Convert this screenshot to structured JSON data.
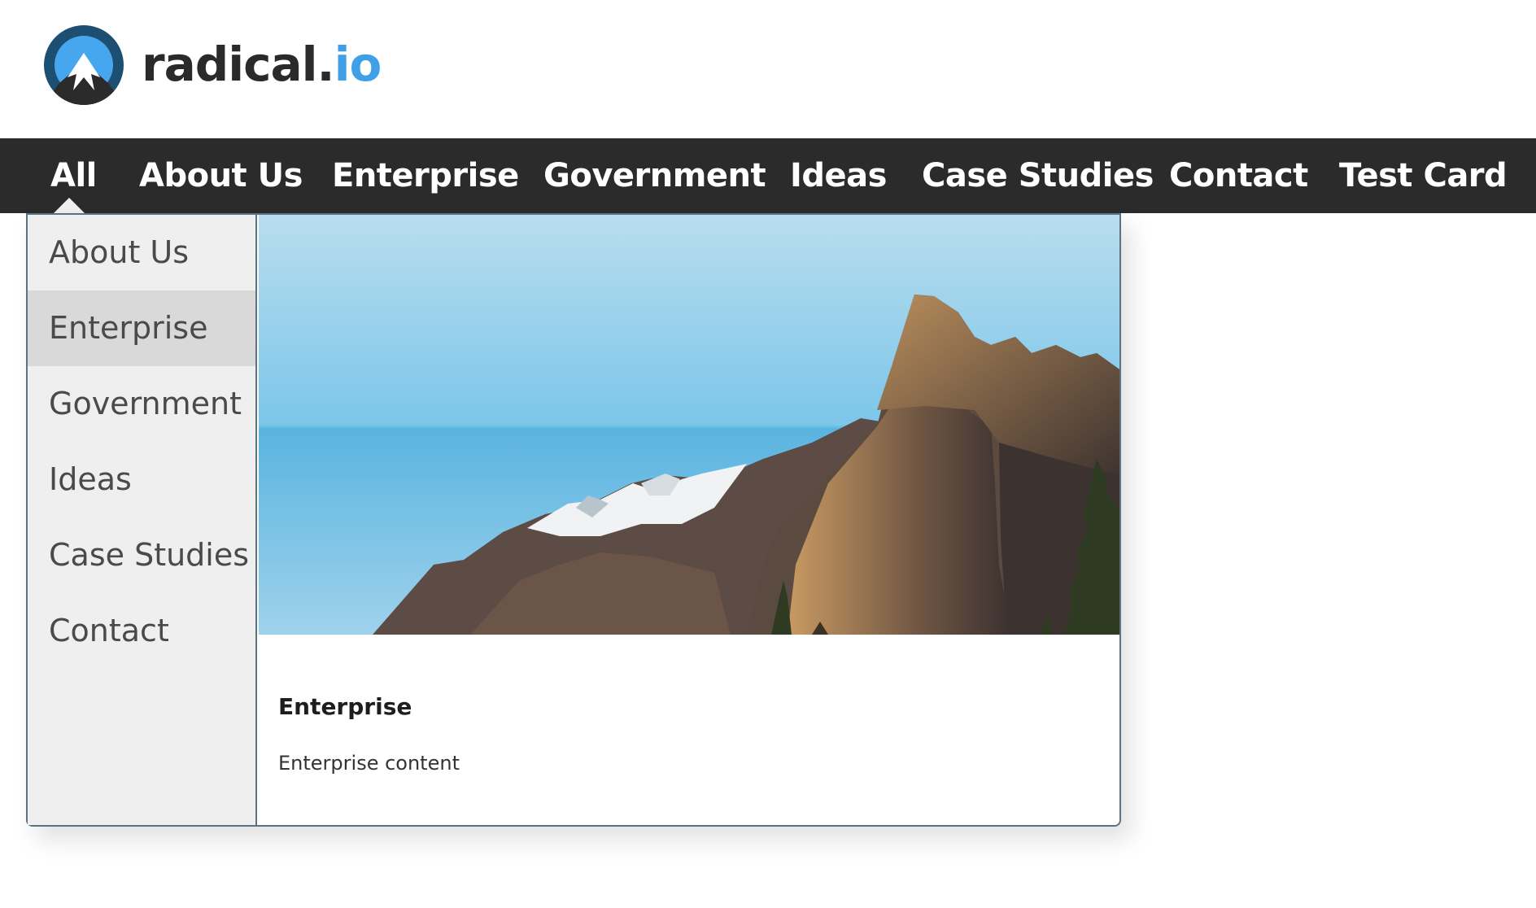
{
  "brand": {
    "name": "radical",
    "dot": ".",
    "tld": "io",
    "accent_color": "#3fa0e8",
    "dark_color": "#2a2a2a"
  },
  "nav": {
    "items": [
      {
        "label": "All"
      },
      {
        "label": "About Us"
      },
      {
        "label": "Enterprise"
      },
      {
        "label": "Government"
      },
      {
        "label": "Ideas"
      },
      {
        "label": "Case Studies"
      },
      {
        "label": "Contact"
      },
      {
        "label": "Test Card"
      }
    ],
    "active": "All",
    "background": "#2b2b2b"
  },
  "dropdown": {
    "items": [
      {
        "label": "About Us"
      },
      {
        "label": "Enterprise"
      },
      {
        "label": "Government"
      },
      {
        "label": "Ideas"
      },
      {
        "label": "Case Studies"
      },
      {
        "label": "Contact"
      }
    ],
    "active": "Enterprise",
    "card": {
      "image_icon": "mountain-landscape-image",
      "title": "Enterprise",
      "text": "Enterprise content"
    }
  }
}
